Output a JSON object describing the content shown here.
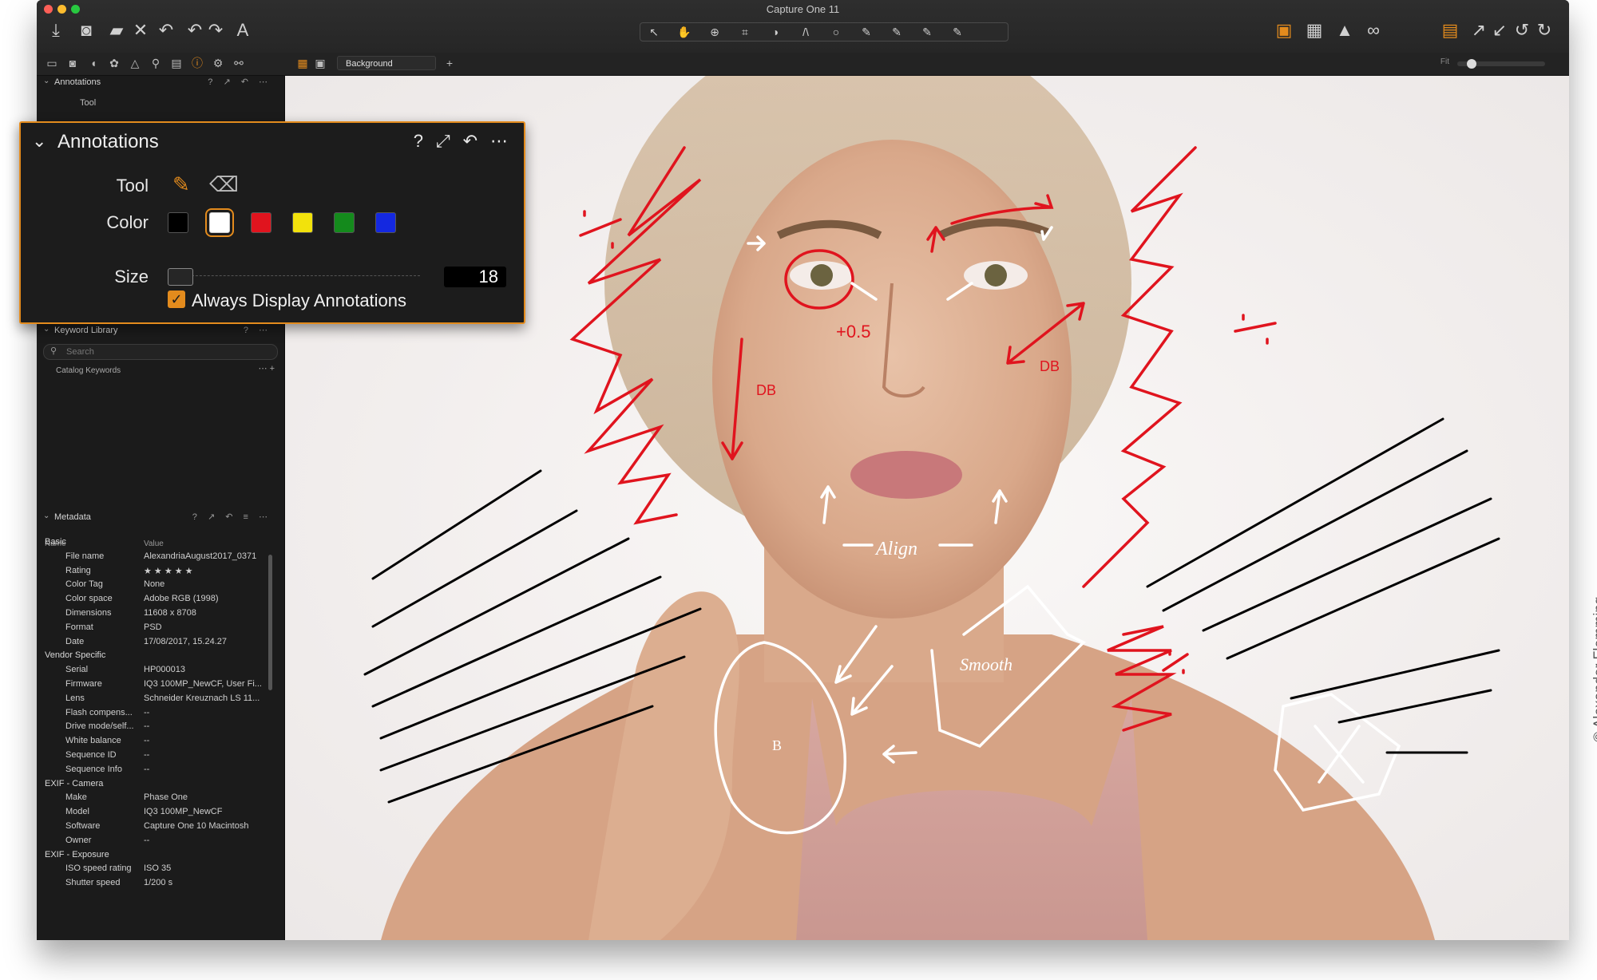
{
  "window": {
    "title": "Capture One 11"
  },
  "toolbar": {
    "left_icons": [
      "import-icon",
      "camera-icon",
      "folder-icon",
      "close-icon",
      "undo-icon",
      "undo2-icon",
      "redo-icon",
      "text-icon"
    ],
    "cursor_tools": [
      "↖",
      "✋",
      "⚲",
      "⌗",
      "◑",
      "/\\",
      "○",
      "✎",
      "✎",
      "✎",
      "✎"
    ],
    "right_icons": [
      "annotate-icon",
      "grid-icon",
      "warning-icon",
      "proof-icon",
      "layers-icon",
      "expand-icon",
      "collapse-icon",
      "rotate-left-icon",
      "rotate-right-icon"
    ]
  },
  "viewer_bar": {
    "variant": "Background",
    "fit": "Fit"
  },
  "left_panel": {
    "annotations_header": "Annotations",
    "tool_label": "Tool",
    "keyword_header": "Keyword Library",
    "search_placeholder": "Search",
    "catalog_keywords": "Catalog Keywords",
    "metadata_header": "Metadata",
    "col_name": "Name",
    "col_value": "Value",
    "rows": [
      {
        "k": "Basic",
        "v": "",
        "group": true
      },
      {
        "k": "File name",
        "v": "AlexandriaAugust2017_0371"
      },
      {
        "k": "Rating",
        "v": "★ ★ ★ ★ ★"
      },
      {
        "k": "Color Tag",
        "v": "None"
      },
      {
        "k": "Color space",
        "v": "Adobe RGB (1998)"
      },
      {
        "k": "Dimensions",
        "v": "11608 x 8708"
      },
      {
        "k": "Format",
        "v": "PSD"
      },
      {
        "k": "Date",
        "v": "17/08/2017, 15.24.27"
      },
      {
        "k": "Vendor Specific",
        "v": "",
        "group": true
      },
      {
        "k": "Serial",
        "v": "HP000013"
      },
      {
        "k": "Firmware",
        "v": "IQ3 100MP_NewCF, User Fi..."
      },
      {
        "k": "Lens",
        "v": "Schneider Kreuznach LS 11..."
      },
      {
        "k": "Flash compens...",
        "v": "--"
      },
      {
        "k": "Drive mode/self...",
        "v": "--"
      },
      {
        "k": "White balance",
        "v": "--"
      },
      {
        "k": "Sequence ID",
        "v": "--"
      },
      {
        "k": "Sequence Info",
        "v": "--"
      },
      {
        "k": "EXIF - Camera",
        "v": "",
        "group": true
      },
      {
        "k": "Make",
        "v": "Phase One"
      },
      {
        "k": "Model",
        "v": "IQ3 100MP_NewCF"
      },
      {
        "k": "Software",
        "v": "Capture One 10 Macintosh"
      },
      {
        "k": "Owner",
        "v": "--"
      },
      {
        "k": "EXIF - Exposure",
        "v": "",
        "group": true
      },
      {
        "k": "ISO speed rating",
        "v": "ISO 35"
      },
      {
        "k": "Shutter speed",
        "v": "1/200 s"
      }
    ]
  },
  "popup": {
    "title": "Annotations",
    "tool_label": "Tool",
    "color_label": "Color",
    "size_label": "Size",
    "size_value": "18",
    "always_display": "Always Display Annotations",
    "always_display_checked": true,
    "colors": [
      "#000000",
      "#ffffff",
      "#e0141e",
      "#f2e20c",
      "#148a1c",
      "#1428e0"
    ],
    "selected_color": "#ffffff"
  },
  "image_annotations": {
    "red": [
      "+0.5",
      "DB",
      "DB"
    ],
    "white": [
      "Align",
      "Smooth",
      "B"
    ]
  },
  "credit": "© Alexander Flemming"
}
